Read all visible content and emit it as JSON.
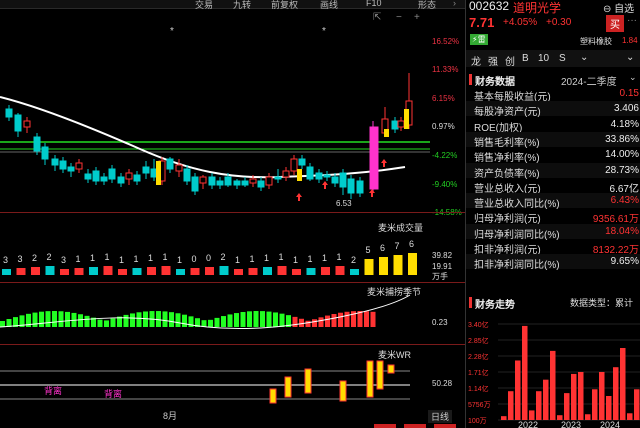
{
  "toolbar": {
    "items": [
      "交易",
      "九转",
      "前复权",
      "画线",
      "F10",
      "形态"
    ]
  },
  "chart": {
    "price_labels": [
      "16.52%",
      "11.33%",
      "6.15%",
      "0.97%",
      "-4.22%",
      "-9.40%",
      "-14.58%"
    ],
    "low_marker": "6.53",
    "volume_panel": {
      "title": "麦米成交量",
      "levels": [
        "39.82",
        "19.91"
      ],
      "unit": "万手",
      "counts": [
        "3",
        "3",
        "2",
        "2",
        "3",
        "1",
        "1",
        "1",
        "1",
        "1",
        "1",
        "1",
        "1",
        "0",
        "0",
        "2",
        "1",
        "1",
        "1",
        "1",
        "1",
        "1",
        "1",
        "1",
        "2",
        "5",
        "6",
        "7",
        "6"
      ]
    },
    "season_panel": {
      "title": "麦米捕捞季节",
      "level": "0.23"
    },
    "wr_panel": {
      "title": "麦米WR",
      "level": "50.28",
      "labels": [
        "背离",
        "背离"
      ]
    },
    "month_label": "8月",
    "period_label": "日线"
  },
  "stock": {
    "code": "002632",
    "name": "道明光学",
    "price": "7.71",
    "change_pct": "+4.05%",
    "change": "+0.30",
    "buy_label": "买",
    "self_select_label": "自选",
    "tag": "雷",
    "industry": "塑料橡胶",
    "industry_change": "1.84",
    "tabs": [
      "龙",
      "强",
      "创",
      "B",
      "10",
      "S"
    ]
  },
  "finance": {
    "title": "财务数据",
    "period": "2024-二季度",
    "rows": [
      {
        "k": "基本每股收益(元)",
        "v": "0.15",
        "color": "red"
      },
      {
        "k": "每股净资产(元)",
        "v": "3.406",
        "color": "white"
      },
      {
        "k": "ROE(加权)",
        "v": "4.18%",
        "color": "white"
      },
      {
        "k": "销售毛利率(%)",
        "v": "33.86%",
        "color": "white"
      },
      {
        "k": "销售净利率(%)",
        "v": "14.00%",
        "color": "white"
      },
      {
        "k": "资产负债率(%)",
        "v": "28.73%",
        "color": "white"
      },
      {
        "k": "营业总收入(元)",
        "v": "6.67亿",
        "color": "white"
      },
      {
        "k": "营业总收入同比(%)",
        "v": "6.43%",
        "color": "red"
      },
      {
        "k": "归母净利润(元)",
        "v": "9356.61万",
        "color": "red"
      },
      {
        "k": "归母净利润同比(%)",
        "v": "18.04%",
        "color": "red"
      },
      {
        "k": "扣非净利润(元)",
        "v": "8132.22万",
        "color": "red"
      },
      {
        "k": "扣非净利润同比(%)",
        "v": "9.65%",
        "color": "white"
      }
    ]
  },
  "trend": {
    "title": "财务走势",
    "type_label": "数据类型：累计",
    "y_labels": [
      "3.40亿",
      "2.85亿",
      "2.28亿",
      "1.71亿",
      "1.14亿",
      "5756万",
      "100万"
    ],
    "x_labels": [
      "2022",
      "2023",
      "2024"
    ],
    "bars": [
      0.04,
      0.3,
      0.62,
      0.98,
      0.1,
      0.3,
      0.42,
      0.72,
      0.05,
      0.28,
      0.48,
      0.5,
      0.06,
      0.32,
      0.5,
      0.25,
      0.55,
      0.75,
      0.07,
      0.32
    ]
  },
  "colors": {
    "up": "#ff3333",
    "down": "#00cccc",
    "accent": "#e34",
    "green": "#22dd22",
    "magenta": "#ff33cc"
  }
}
